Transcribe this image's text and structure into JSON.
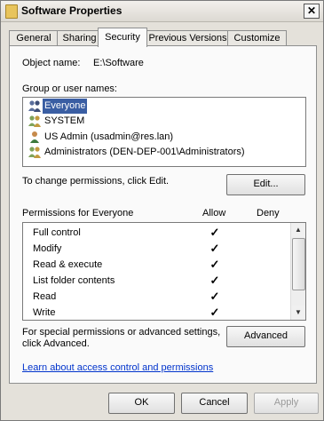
{
  "window": {
    "title": "Software Properties",
    "close_glyph": "✕"
  },
  "tabs": [
    {
      "label": "General"
    },
    {
      "label": "Sharing"
    },
    {
      "label": "Security"
    },
    {
      "label": "Previous Versions"
    },
    {
      "label": "Customize"
    }
  ],
  "object": {
    "label": "Object name:",
    "value": "E:\\Software"
  },
  "groups": {
    "label": "Group or user names:",
    "items": [
      {
        "name": "Everyone",
        "icon": "group-icon",
        "selected": true
      },
      {
        "name": "SYSTEM",
        "icon": "group-icon",
        "selected": false
      },
      {
        "name": "US Admin (usadmin@res.lan)",
        "icon": "user-icon",
        "selected": false
      },
      {
        "name": "Administrators (DEN-DEP-001\\Administrators)",
        "icon": "group-icon",
        "selected": false
      }
    ]
  },
  "change_hint": "To change permissions, click Edit.",
  "edit_button": "Edit...",
  "permissions": {
    "label": "Permissions for Everyone",
    "allow_header": "Allow",
    "deny_header": "Deny",
    "rows": [
      {
        "name": "Full control",
        "allow": "✓",
        "deny": ""
      },
      {
        "name": "Modify",
        "allow": "✓",
        "deny": ""
      },
      {
        "name": "Read & execute",
        "allow": "✓",
        "deny": ""
      },
      {
        "name": "List folder contents",
        "allow": "✓",
        "deny": ""
      },
      {
        "name": "Read",
        "allow": "✓",
        "deny": ""
      },
      {
        "name": "Write",
        "allow": "✓",
        "deny": ""
      }
    ]
  },
  "advanced_hint": [
    "For special permissions or advanced settings,",
    "click Advanced."
  ],
  "advanced_button": "Advanced",
  "learn_link": "Learn about access control and permissions",
  "footer": {
    "ok": "OK",
    "cancel": "Cancel",
    "apply": "Apply"
  },
  "colors": {
    "selection": "#3a5ea3",
    "link": "#0033cc"
  }
}
